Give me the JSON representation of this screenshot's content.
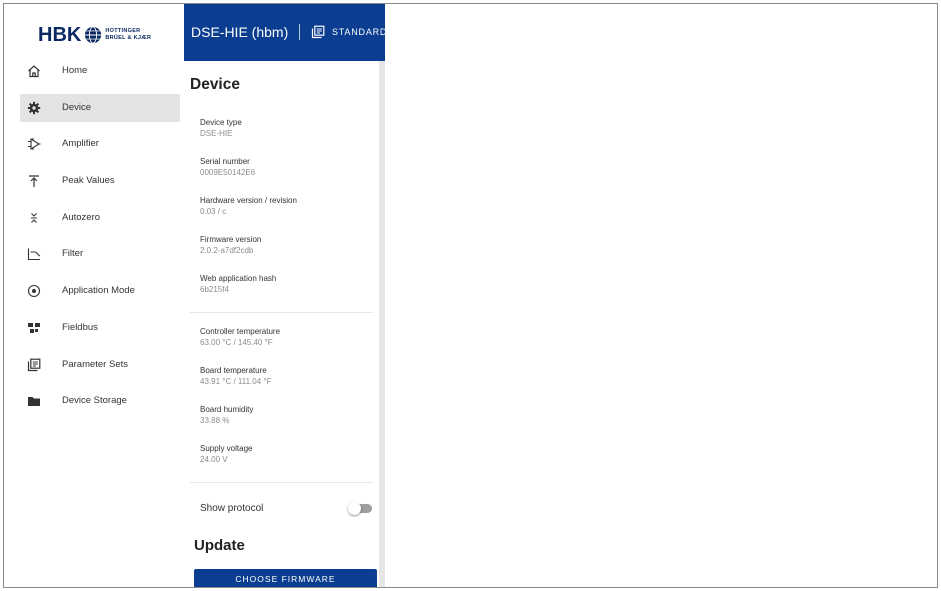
{
  "brand": {
    "logo_text": "HBK",
    "logo_sub_line1": "HOTTINGER",
    "logo_sub_line2": "BRÜEL & KJÆR",
    "color": "#0b2a63"
  },
  "header": {
    "title": "DSE-HIE (hbm)",
    "parameter_set": "STANDARD",
    "background": "#0b3d91"
  },
  "sidebar": {
    "items": [
      {
        "label": "Home",
        "icon": "home-icon",
        "active": false
      },
      {
        "label": "Device",
        "icon": "gear-icon",
        "active": true
      },
      {
        "label": "Amplifier",
        "icon": "amplifier-icon",
        "active": false
      },
      {
        "label": "Peak Values",
        "icon": "peak-values-icon",
        "active": false
      },
      {
        "label": "Autozero",
        "icon": "autozero-icon",
        "active": false
      },
      {
        "label": "Filter",
        "icon": "filter-icon",
        "active": false
      },
      {
        "label": "Application Mode",
        "icon": "target-icon",
        "active": false
      },
      {
        "label": "Fieldbus",
        "icon": "fieldbus-icon",
        "active": false
      },
      {
        "label": "Parameter Sets",
        "icon": "parameter-sets-icon",
        "active": false
      },
      {
        "label": "Device Storage",
        "icon": "folder-icon",
        "active": false
      }
    ]
  },
  "device": {
    "heading": "Device",
    "info": [
      {
        "label": "Device type",
        "value": "DSE-HIE"
      },
      {
        "label": "Serial number",
        "value": "0009E50142E6"
      },
      {
        "label": "Hardware version / revision",
        "value": "0.03 / c"
      },
      {
        "label": "Firmware version",
        "value": "2.0.2-a7df2cdb"
      },
      {
        "label": "Web application hash",
        "value": "6b215f4"
      }
    ],
    "status": [
      {
        "label": "Controller temperature",
        "value": "63.00 °C / 145.40 °F"
      },
      {
        "label": "Board temperature",
        "value": "43.91 °C / 111.04 °F"
      },
      {
        "label": "Board humidity",
        "value": "33.88 %"
      },
      {
        "label": "Supply voltage",
        "value": "24.00 V"
      }
    ],
    "show_protocol_label": "Show protocol",
    "show_protocol_enabled": false
  },
  "update": {
    "heading": "Update",
    "choose_firmware_label": "CHOOSE FIRMWARE"
  }
}
